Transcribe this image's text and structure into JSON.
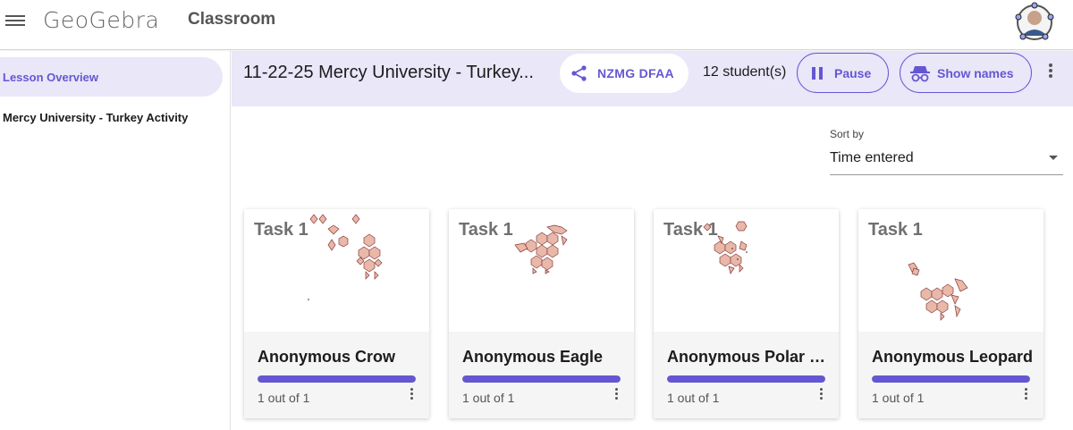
{
  "app": {
    "logo_text": "GeoGebra",
    "name": "Classroom"
  },
  "sidebar": {
    "items": [
      {
        "label": "Lesson Overview"
      },
      {
        "label": "Mercy University - Turkey Activity"
      }
    ]
  },
  "header": {
    "title": "11-22-25 Mercy University - Turkey...",
    "code": "NZMG DFAA",
    "students": "12 student(s)",
    "pause_label": "Pause",
    "show_names_label": "Show names"
  },
  "sort": {
    "label": "Sort by",
    "value": "Time entered"
  },
  "cards": [
    {
      "task": "Task 1",
      "name": "Anonymous Crow",
      "progress_text": "1 out of 1",
      "progress": 1.0
    },
    {
      "task": "Task 1",
      "name": "Anonymous Eagle",
      "progress_text": "1 out of 1",
      "progress": 1.0
    },
    {
      "task": "Task 1",
      "name": "Anonymous Polar B...",
      "progress_text": "1 out of 1",
      "progress": 1.0
    },
    {
      "task": "Task 1",
      "name": "Anonymous Leopard",
      "progress_text": "1 out of 1",
      "progress": 1.0
    }
  ],
  "colors": {
    "accent": "#6557d2",
    "header_bg": "#e9e7f8",
    "shape_fill": "#e8b8a8",
    "shape_stroke": "#8a3a3a"
  },
  "icons": [
    "menu-icon",
    "share-icon",
    "pause-icon",
    "incognito-icon",
    "more-vert-icon",
    "dropdown-caret-icon",
    "avatar"
  ]
}
